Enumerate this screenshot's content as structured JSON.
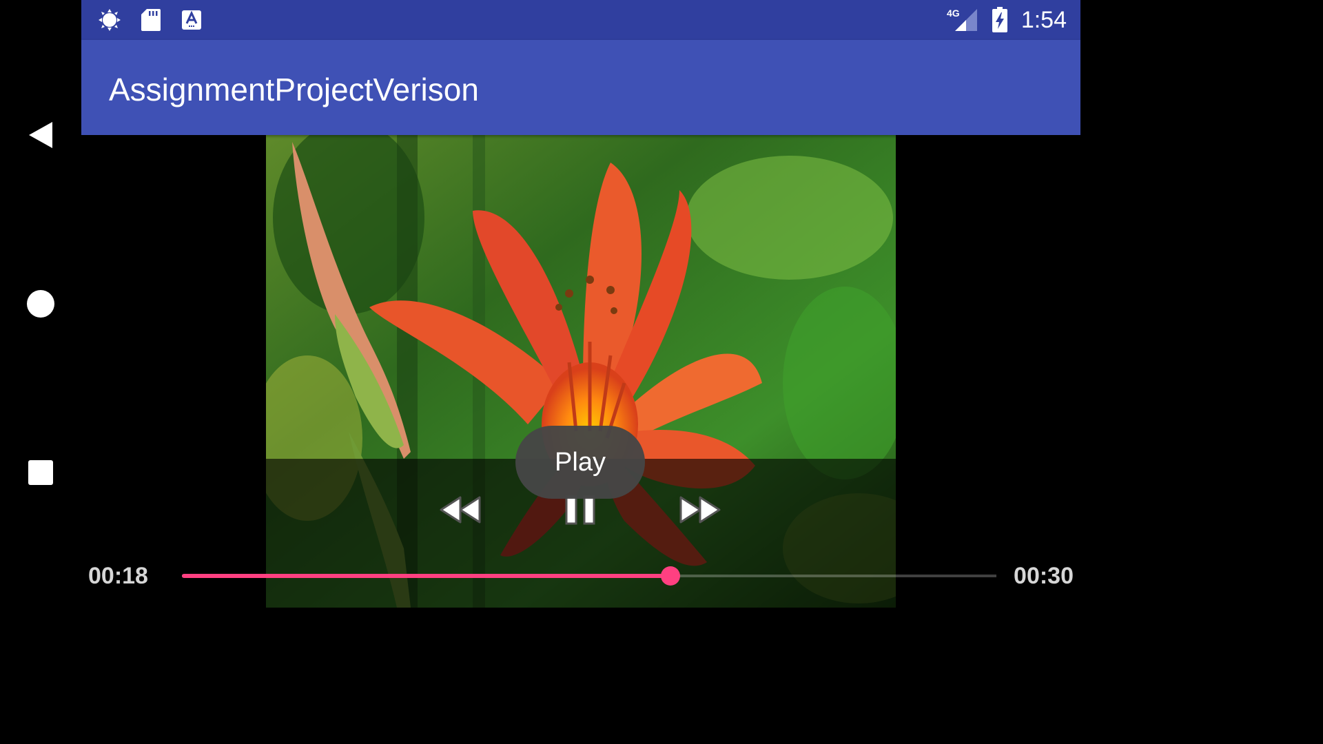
{
  "status_bar": {
    "time": "1:54",
    "network": "4G",
    "left_icons": [
      "brightness-icon",
      "sd-card-icon",
      "keyboard-a-icon"
    ],
    "right_icons": [
      "signal-icon",
      "battery-charging-icon"
    ]
  },
  "app_bar": {
    "title": "AssignmentProjectVerison"
  },
  "navigation_bar": {
    "buttons": [
      "back-icon",
      "home-icon",
      "recents-icon"
    ]
  },
  "media_controller": {
    "current_time": "00:18",
    "total_time": "00:30",
    "progress_fraction": 0.6,
    "buttons": [
      "rewind-icon",
      "pause-icon",
      "fast-forward-icon"
    ]
  },
  "toast": {
    "text": "Play"
  },
  "colors": {
    "status_bar": "#303F9F",
    "app_bar": "#3F51B5",
    "accent": "#FF4081"
  }
}
